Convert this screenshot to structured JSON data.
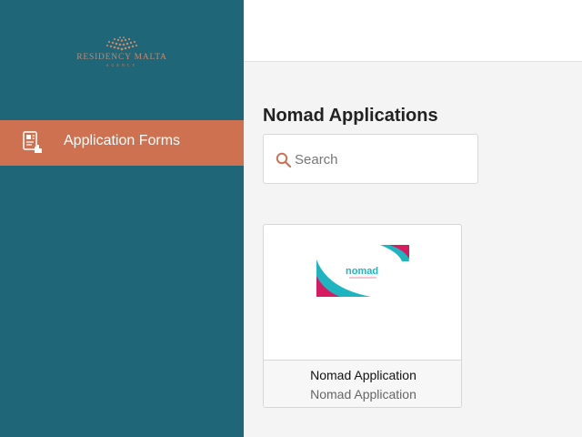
{
  "brand": {
    "name": "RESIDENCY MALTA",
    "subname": "AGENCY",
    "color": "#c9876a"
  },
  "sidebar": {
    "background": "#1f6678",
    "items": [
      {
        "label": "Application Forms",
        "icon": "application-form-icon",
        "active": true,
        "active_color": "#cd7150"
      }
    ]
  },
  "main": {
    "title": "Nomad Applications",
    "search": {
      "placeholder": "Search",
      "value": "",
      "icon": "search-icon"
    },
    "cards": [
      {
        "title": "Nomad Application",
        "subtitle": "Nomad Application",
        "image_logo_text": "nomad",
        "image_accent_colors": [
          "#1fb5c0",
          "#d81b60"
        ]
      }
    ]
  }
}
